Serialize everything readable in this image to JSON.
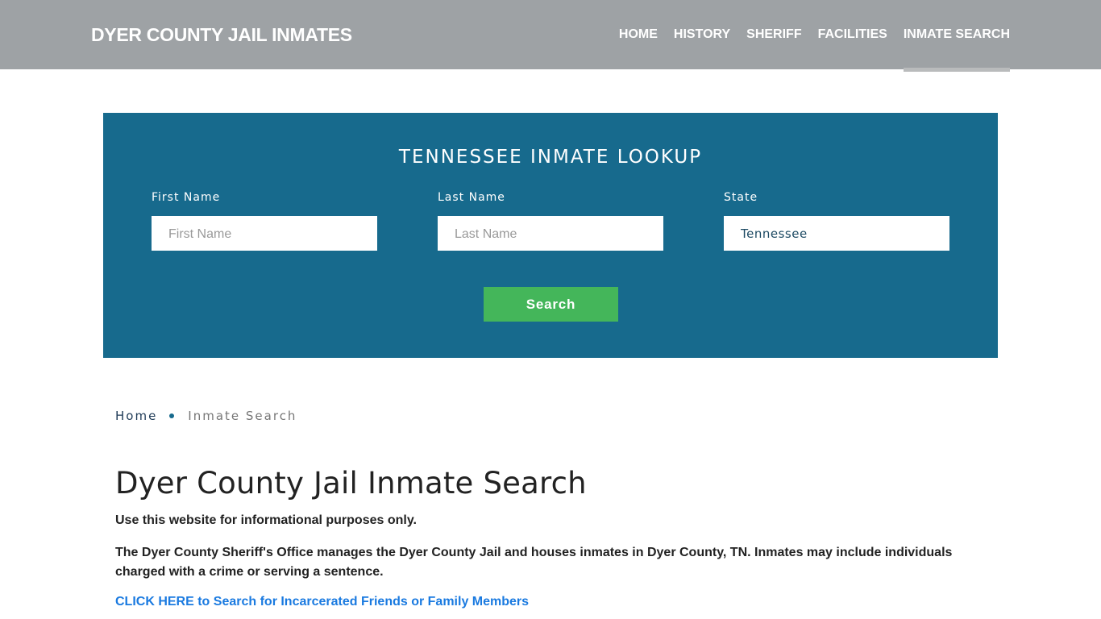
{
  "header": {
    "brand": "DYER COUNTY JAIL INMATES",
    "nav": [
      {
        "label": "HOME",
        "active": false
      },
      {
        "label": "HISTORY",
        "active": false
      },
      {
        "label": "SHERIFF",
        "active": false
      },
      {
        "label": "FACILITIES",
        "active": false
      },
      {
        "label": "INMATE SEARCH",
        "active": true
      }
    ]
  },
  "lookup": {
    "title": "TENNESSEE INMATE LOOKUP",
    "first_name": {
      "label": "First Name",
      "placeholder": "First Name",
      "value": ""
    },
    "last_name": {
      "label": "Last Name",
      "placeholder": "Last Name",
      "value": ""
    },
    "state": {
      "label": "State",
      "value": "Tennessee"
    },
    "search_label": "Search"
  },
  "breadcrumb": {
    "home": "Home",
    "current": "Inmate Search"
  },
  "content": {
    "title": "Dyer County Jail Inmate Search",
    "disclaimer": "Use this website for informational purposes only.",
    "description": "The Dyer County Sheriff's Office manages the Dyer County Jail and houses inmates in Dyer County, TN. Inmates may include individuals charged with a crime or serving a sentence.",
    "cta_link": "CLICK HERE to Search for Incarcerated Friends or Family Members"
  },
  "colors": {
    "header_bg": "#9ea2a5",
    "panel_bg": "#176a8d",
    "button_bg": "#44b65a",
    "link": "#1a7ae0"
  }
}
